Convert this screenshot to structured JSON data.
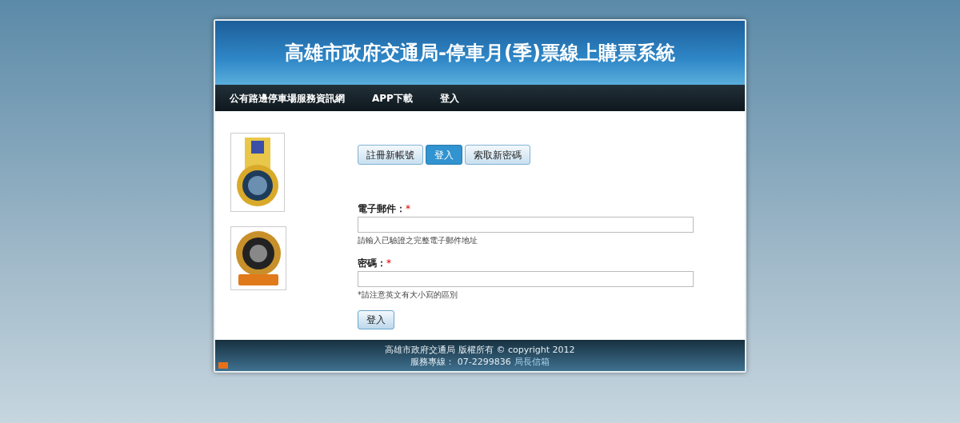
{
  "header": {
    "title": "高雄市政府交通局-停車月(季)票線上購票系統"
  },
  "nav": {
    "items": [
      {
        "label": "公有路邊停車場服務資訊網"
      },
      {
        "label": "APP下載"
      },
      {
        "label": "登入"
      }
    ]
  },
  "tabs": [
    {
      "label": "註冊新帳號",
      "selected": false
    },
    {
      "label": "登入",
      "selected": true
    },
    {
      "label": "索取新密碼",
      "selected": false
    }
  ],
  "form": {
    "fields": [
      {
        "label": "電子郵件：",
        "required_mark": "*",
        "hint": "請輸入已驗證之完整電子郵件地址"
      },
      {
        "label": "密碼：",
        "required_mark": "*",
        "hint": "*請注意英文有大小寫的區別"
      }
    ],
    "submit": "登入"
  },
  "footer": {
    "copyright": "高雄市政府交通局 版權所有 © copyright 2012",
    "hotline": "服務專線： 07-2299836",
    "link": "局長信箱"
  }
}
